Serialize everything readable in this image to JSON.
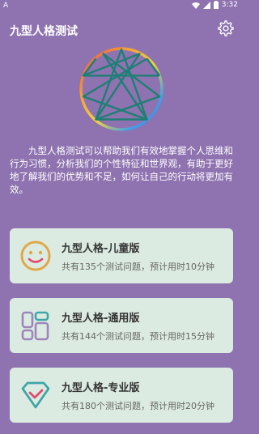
{
  "status_bar": {
    "left_badge": "A",
    "time": "3:32"
  },
  "header": {
    "title": "九型人格测试"
  },
  "intro": "九型人格测试可以帮助我们有效地掌握个人思维和行为习惯，分析我们的个性特征和世界观，有助于更好地了解我们的优势和不足，如何让自己的行动将更加有效。",
  "cards": [
    {
      "title": "九型人格-儿童版",
      "desc": "共有135个测试问题，预计用时10分钟",
      "icon": "smiley-icon"
    },
    {
      "title": "九型人格-通用版",
      "desc": "共有144个测试问题，预计用时15分钟",
      "icon": "grid-apps-icon"
    },
    {
      "title": "九型人格-专业版",
      "desc": "共有180个测试问题，预计用时20分钟",
      "icon": "diamond-check-icon"
    }
  ],
  "colors": {
    "background": "#8E73B0",
    "card_background": "#DCEBE1",
    "enneagram_lines": "#1E7F74",
    "kids_icon": "#E0A84A",
    "general_icon": "#9C86BA",
    "pro_icon": "#3FA6A8",
    "pro_check": "#E24B6F"
  }
}
